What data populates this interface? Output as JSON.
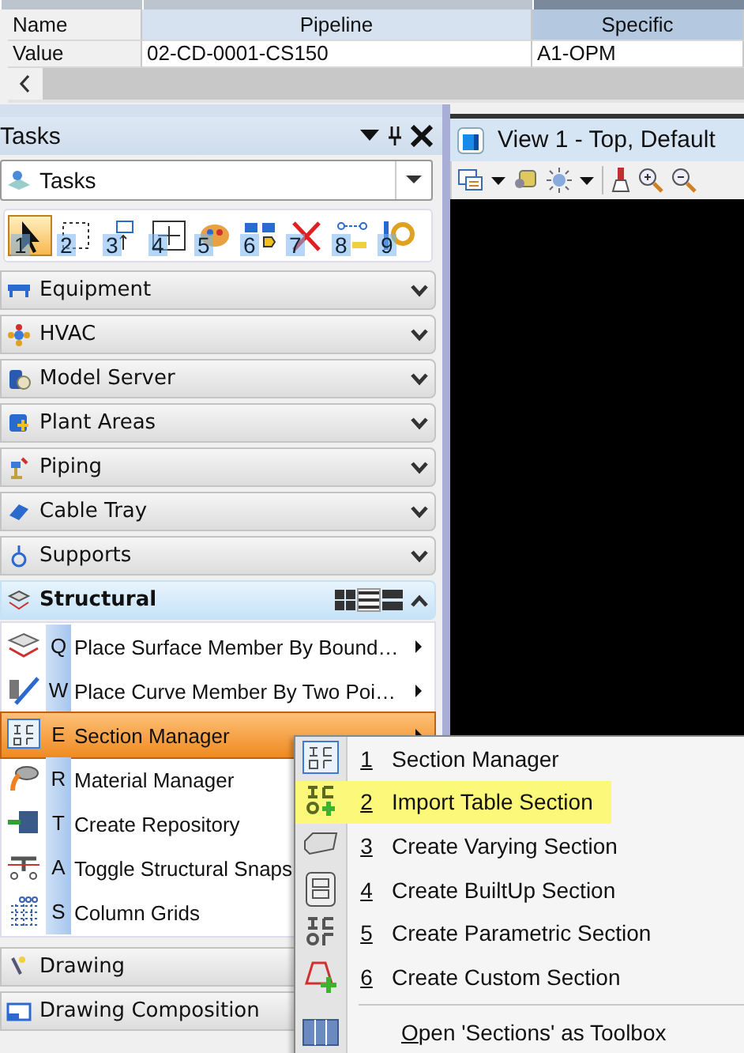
{
  "table": {
    "rows": [
      {
        "cells": [
          "Name",
          "Pipeline",
          "Specific"
        ]
      },
      {
        "cells": [
          "Value",
          "02-CD-0001-CS150",
          "A1-OPM"
        ]
      }
    ]
  },
  "tasks_panel": {
    "title": "Tasks",
    "dropdown": {
      "value": "Tasks"
    },
    "tools": [
      {
        "label": "1",
        "selected": true
      },
      {
        "label": "2",
        "selected": false
      },
      {
        "label": "3",
        "selected": false
      },
      {
        "label": "4",
        "selected": false
      },
      {
        "label": "5",
        "selected": false
      },
      {
        "label": "6",
        "selected": false
      },
      {
        "label": "7",
        "selected": false
      },
      {
        "label": "8",
        "selected": false
      },
      {
        "label": "9",
        "selected": false
      }
    ],
    "categories": [
      {
        "label": "Equipment",
        "expanded": false
      },
      {
        "label": "HVAC",
        "expanded": false
      },
      {
        "label": "Model Server",
        "expanded": false
      },
      {
        "label": "Plant Areas",
        "expanded": false
      },
      {
        "label": "Piping",
        "expanded": false
      },
      {
        "label": "Cable Tray",
        "expanded": false
      },
      {
        "label": "Supports",
        "expanded": false
      },
      {
        "label": "Structural",
        "expanded": true,
        "items": [
          {
            "key": "Q",
            "label": "Place Surface Member By Bound…",
            "submenu": true,
            "selected": false
          },
          {
            "key": "W",
            "label": "Place Curve Member By Two Poi…",
            "submenu": true,
            "selected": false
          },
          {
            "key": "E",
            "label": "Section Manager",
            "submenu": true,
            "selected": true
          },
          {
            "key": "R",
            "label": "Material Manager",
            "submenu": false,
            "selected": false
          },
          {
            "key": "T",
            "label": "Create Repository",
            "submenu": false,
            "selected": false
          },
          {
            "key": "A",
            "label": "Toggle Structural Snaps",
            "submenu": false,
            "selected": false
          },
          {
            "key": "S",
            "label": "Column Grids",
            "submenu": false,
            "selected": false
          }
        ]
      },
      {
        "label": "Drawing",
        "expanded": false
      },
      {
        "label": "Drawing Composition",
        "expanded": false
      }
    ]
  },
  "view": {
    "title": "View 1 - Top, Default"
  },
  "context_menu": {
    "items": [
      {
        "key": "1",
        "label": "Section Manager",
        "selected": false
      },
      {
        "key": "2",
        "label": "Import Table Section",
        "selected": true
      },
      {
        "key": "3",
        "label": "Create Varying Section",
        "selected": false
      },
      {
        "key": "4",
        "label": "Create BuiltUp Section",
        "selected": false
      },
      {
        "key": "5",
        "label": "Create Parametric Section",
        "selected": false
      },
      {
        "key": "6",
        "label": "Create Custom Section",
        "selected": false
      },
      {
        "label": "Open 'Sections' as Toolbox",
        "mnemonic_first": true,
        "selected": false
      }
    ]
  }
}
